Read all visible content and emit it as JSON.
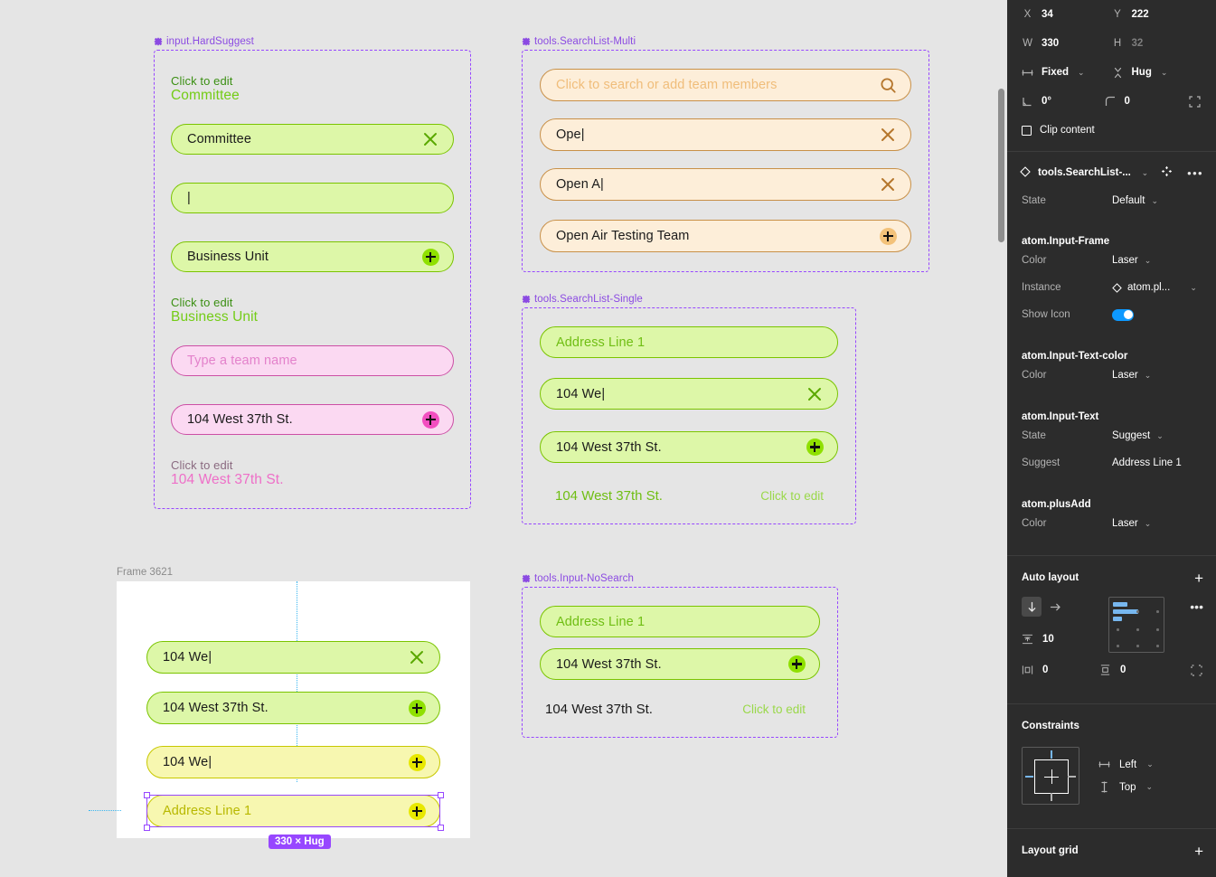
{
  "canvas": {
    "components": [
      {
        "name": "input.HardSuggest",
        "rows": [
          {
            "kind": "hint",
            "small": "Click to edit",
            "big": "Committee",
            "tone": "green"
          },
          {
            "kind": "pill",
            "tone": "green",
            "text": "Committee",
            "icon": "close-icon"
          },
          {
            "kind": "pill",
            "tone": "green",
            "text": "",
            "icon": "none",
            "caret": true
          },
          {
            "kind": "pill",
            "tone": "green",
            "text": "Business Unit",
            "icon": "plus-icon"
          },
          {
            "kind": "hint",
            "small": "Click to edit",
            "big": "Business Unit",
            "tone": "green"
          },
          {
            "kind": "pill",
            "tone": "pink",
            "ghost": true,
            "text": "Type a team name",
            "icon": "none"
          },
          {
            "kind": "pill",
            "tone": "pink",
            "text": "104 West 37th St.",
            "icon": "plus-icon"
          },
          {
            "kind": "hint",
            "small": "Click to edit",
            "big": "104 West 37th St.",
            "tone": "pink"
          }
        ]
      },
      {
        "name": "tools.SearchList-Multi",
        "rows": [
          {
            "kind": "pill",
            "tone": "orange",
            "ghost": true,
            "text": "Click to search or add team members",
            "icon": "search-icon"
          },
          {
            "kind": "pill",
            "tone": "orange",
            "text": "Ope",
            "caret": true,
            "icon": "close-icon"
          },
          {
            "kind": "pill",
            "tone": "orange",
            "text": "Open A",
            "caret": true,
            "icon": "close-icon"
          },
          {
            "kind": "pill",
            "tone": "orange",
            "text": "Open Air Testing Team",
            "icon": "plus-icon"
          }
        ]
      },
      {
        "name": "tools.SearchList-Single",
        "rows": [
          {
            "kind": "pill",
            "tone": "green",
            "ghost": true,
            "text": "Address Line 1",
            "icon": "none"
          },
          {
            "kind": "pill",
            "tone": "green",
            "text": "104 We",
            "caret": true,
            "icon": "close-icon"
          },
          {
            "kind": "pill",
            "tone": "green",
            "text": "104 West 37th St.",
            "icon": "plus-icon"
          },
          {
            "kind": "foot",
            "left": "104 West 37th St.",
            "right": "Click to edit",
            "tone": "green"
          }
        ]
      },
      {
        "name": "tools.Input-NoSearch",
        "rows": [
          {
            "kind": "pill",
            "tone": "green",
            "ghost": true,
            "text": "Address Line 1",
            "icon": "none"
          },
          {
            "kind": "pill",
            "tone": "green",
            "text": "104 West 37th St.",
            "icon": "plus-icon"
          },
          {
            "kind": "foot",
            "left": "104 West 37th St.",
            "right": "Click to edit",
            "tone": "dark"
          }
        ]
      }
    ],
    "frame": {
      "title": "Frame 3621",
      "size_badge": "330 × Hug",
      "rows": [
        {
          "tone": "green",
          "text": "104 We",
          "caret": true,
          "icon": "close-icon"
        },
        {
          "tone": "green",
          "text": "104 West 37th St.",
          "icon": "plus-icon"
        },
        {
          "tone": "yellow",
          "text": "104 We",
          "caret": true,
          "icon": "plus-icon"
        },
        {
          "tone": "yellow",
          "ghost": true,
          "text": "Address Line 1",
          "icon": "plus-icon",
          "selected": true
        }
      ]
    }
  },
  "panel": {
    "position": {
      "x_label": "X",
      "x_value": "34",
      "y_label": "Y",
      "y_value": "222",
      "w_label": "W",
      "w_value": "330",
      "h_label": "H",
      "h_value": "32",
      "horizontal_resizing": "Fixed",
      "vertical_resizing": "Hug",
      "rotation": "0°",
      "corner_radius": "0",
      "clip_content_label": "Clip content"
    },
    "component": {
      "name": "tools.SearchList-...",
      "properties": [
        {
          "key": "State",
          "value": "Default",
          "type": "select"
        }
      ],
      "sections": [
        {
          "title": "atom.Input-Frame",
          "properties": [
            {
              "key": "Color",
              "value": "Laser",
              "type": "select"
            },
            {
              "key": "Instance",
              "value": "atom.pl...",
              "type": "instance"
            },
            {
              "key": "Show Icon",
              "value": "on",
              "type": "toggle"
            }
          ]
        },
        {
          "title": "atom.Input-Text-color",
          "properties": [
            {
              "key": "Color",
              "value": "Laser",
              "type": "select"
            }
          ]
        },
        {
          "title": "atom.Input-Text",
          "properties": [
            {
              "key": "State",
              "value": "Suggest",
              "type": "select"
            },
            {
              "key": "Suggest",
              "value": "Address Line 1",
              "type": "text"
            }
          ]
        },
        {
          "title": "atom.plusAdd",
          "properties": [
            {
              "key": "Color",
              "value": "Laser",
              "type": "select"
            }
          ]
        }
      ]
    },
    "auto_layout": {
      "title": "Auto layout",
      "gap": "10",
      "padding_horizontal": "0",
      "padding_vertical": "0"
    },
    "constraints": {
      "title": "Constraints",
      "horizontal": "Left",
      "vertical": "Top"
    },
    "layout_grid": {
      "title": "Layout grid"
    }
  },
  "colors": {
    "accent_purple": "#9747ff",
    "laser_green": "#8fe000",
    "panel_bg": "#2c2c2c",
    "canvas_bg": "#e5e5e5",
    "toggle_blue": "#0d99ff"
  }
}
